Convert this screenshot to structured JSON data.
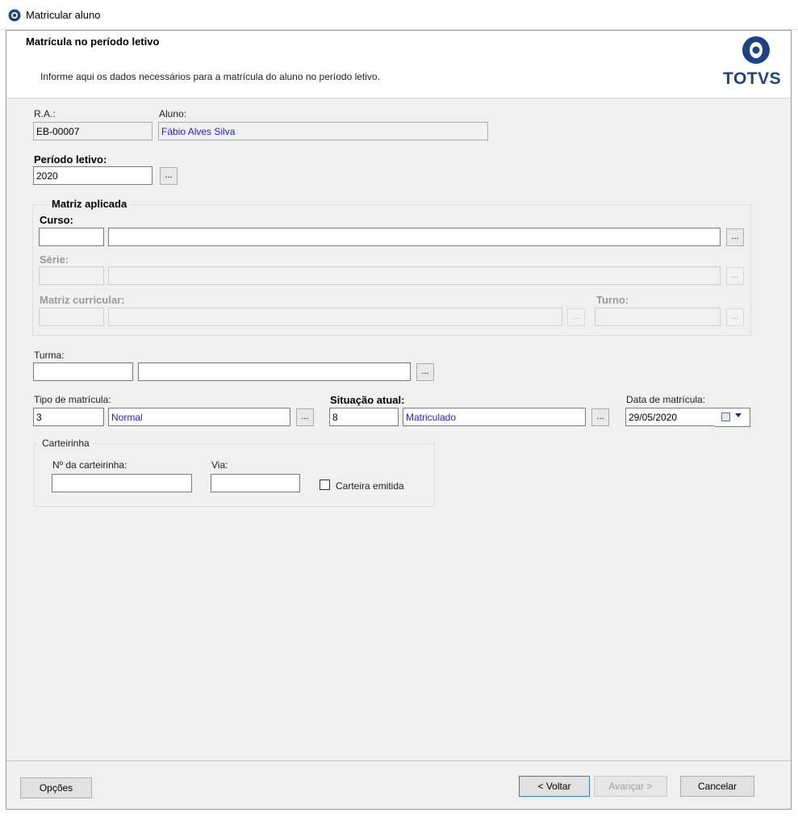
{
  "window": {
    "title": "Matricular aluno"
  },
  "header": {
    "title": "Matrícula no período letivo",
    "subtitle": "Informe aqui os dados necessários para a matrícula do aluno no período letivo.",
    "logo_text": "TOTVS",
    "logo_color": "#1d4386"
  },
  "student": {
    "ra_label": "R.A.:",
    "ra_value": "EB-00007",
    "name_label": "Aluno:",
    "name_value": "Fábio Alves Silva"
  },
  "period": {
    "label": "Período letivo:",
    "value": "2020",
    "lookup_label": "..."
  },
  "matrix": {
    "legend": "Matriz aplicada",
    "curso_label": "Curso:",
    "curso_code": "",
    "curso_desc": "",
    "serie_label": "Série:",
    "serie_code": "",
    "serie_desc": "",
    "matriz_label": "Matriz curricular:",
    "matriz_code": "",
    "matriz_desc": "",
    "turno_label": "Turno:",
    "turno_value": "",
    "lookup_label": "..."
  },
  "turma": {
    "label": "Turma:",
    "code": "",
    "desc": "",
    "lookup_label": "..."
  },
  "enrollment": {
    "tipo_label": "Tipo de matrícula:",
    "tipo_code": "3",
    "tipo_desc": "Normal",
    "situacao_label": "Situação atual:",
    "situacao_code": "8",
    "situacao_desc": "Matriculado",
    "data_label": "Data de matrícula:",
    "data_value": "29/05/2020",
    "lookup_label": "..."
  },
  "card": {
    "legend": "Carteirinha",
    "numero_label": "Nº da carteirinha:",
    "numero_value": "",
    "via_label": "Via:",
    "via_value": "",
    "emitida_label": "Carteira emitida",
    "emitida_checked": false
  },
  "footer": {
    "options": "Opções",
    "back": "< Voltar",
    "next": "Avançar >",
    "cancel": "Cancelar"
  },
  "colors": {
    "accent_blue_text": "#1f1fd6",
    "dialog_bg": "#f0f0f0"
  }
}
